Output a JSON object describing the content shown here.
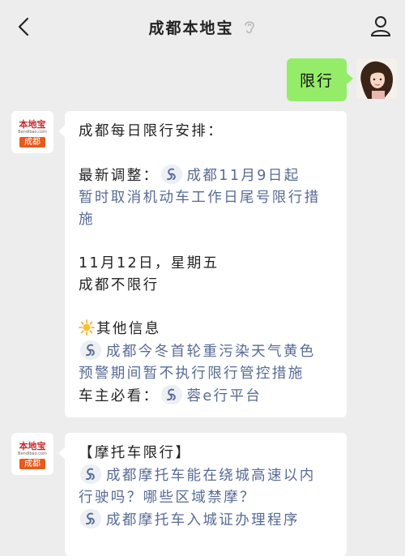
{
  "header": {
    "title": "成都本地宝"
  },
  "outgoing": {
    "text": "限行"
  },
  "bot": {
    "logo_text": "本地宝",
    "logo_url": "Bendibao.com",
    "logo_city": "成都"
  },
  "message1": {
    "title": "成都每日限行安排：",
    "latest_label": "最新调整：",
    "latest_link_l1": "成都11月9日起",
    "latest_link_l2": "暂时取消机动车工作日尾号限行措",
    "latest_link_l3": "施",
    "date": "11月12日，星期五",
    "status": "成都不限行",
    "other_info": "其他信息",
    "info_link_l1": "成都今冬首轮重污染天气黄色",
    "info_link_l2": "预警期间暂不执行限行管控措施",
    "owner_label": "车主必看：",
    "owner_link": "蓉e行平台"
  },
  "message2": {
    "title": "【摩托车限行】",
    "link1_l1": "成都摩托车能在绕城高速以内",
    "link1_l2": "行驶吗？哪些区域禁摩？",
    "link2": "成都摩托车入城证办理程序"
  },
  "colors": {
    "background": "#ededed",
    "outgoing_bubble": "#95ec69",
    "link": "#576b95",
    "logo_city_bg": "#e65a1c"
  },
  "icons": [
    "back-arrow-icon",
    "mute-ear-icon",
    "profile-icon",
    "mini-program-icon",
    "sun-icon"
  ]
}
